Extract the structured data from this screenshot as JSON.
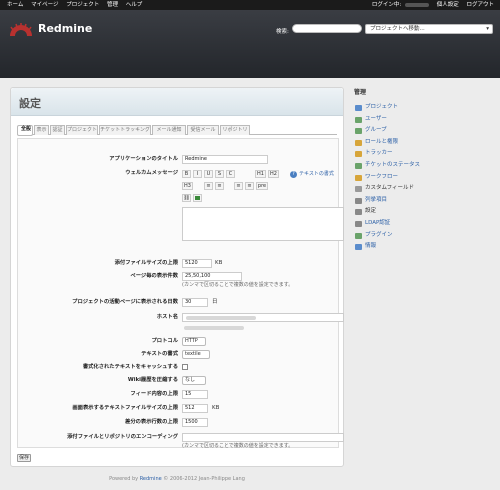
{
  "topmenu": {
    "left": [
      "ホーム",
      "マイページ",
      "プロジェクト",
      "管理",
      "ヘルプ"
    ],
    "login": "ログイン中:",
    "account": "個人設定",
    "logout": "ログアウト"
  },
  "header": {
    "brand": "Redmine",
    "search_label": "検索:",
    "jump": "プロジェクトへ移動..."
  },
  "page": {
    "title": "設定"
  },
  "tabs": [
    "全般",
    "表示",
    "認証",
    "プロジェクト",
    "チケットトラッキング",
    "メール通知",
    "受信メール",
    "リポジトリ"
  ],
  "form": {
    "app_title_label": "アプリケーションのタイトル",
    "app_title": "Redmine",
    "welcome_label": "ウェルカムメッセージ",
    "text_format_link": "テキストの書式",
    "toolbar": [
      "B",
      "I",
      "U",
      "S",
      "C",
      "H1",
      "H2",
      "H3",
      "≡",
      "≡",
      "≡",
      "≡",
      "pre"
    ],
    "attach_label": "添付ファイルサイズの上限",
    "attach_value": "5120",
    "attach_unit": "KB",
    "per_page_label": "ページ毎の表示件数",
    "per_page_value": "25,50,100",
    "per_page_note": "(カンマで区切ることで複数の値を設定できます。",
    "activity_label": "プロジェクトの活動ページに表示される日数",
    "activity_value": "30",
    "activity_unit": "日",
    "hostname_label": "ホスト名",
    "protocol_label": "プロトコル",
    "protocol_value": "HTTP",
    "textformat_label": "テキストの書式",
    "textformat_value": "textile",
    "cache_label": "書式化されたテキストをキャッシュする",
    "wiki_label": "Wiki履歴を圧縮する",
    "wiki_value": "なし",
    "feed_label": "フィード内容の上限",
    "feed_value": "15",
    "filesize_label": "画面表示するテキストファイルサイズの上限",
    "filesize_value": "512",
    "filesize_unit": "KB",
    "diff_label": "差分の表示行数の上限",
    "diff_value": "1500",
    "encoding_label": "添付ファイルとリポジトリのエンコーディング",
    "encoding_note": "(カンマで区切ることで複数の値を設定できます。"
  },
  "save_label": "保存",
  "sidebar": {
    "title": "管理",
    "items": [
      {
        "label": "プロジェクト",
        "color": "#5a8ccc"
      },
      {
        "label": "ユーザー",
        "color": "#6aa36a"
      },
      {
        "label": "グループ",
        "color": "#6aa36a"
      },
      {
        "label": "ロールと権限",
        "color": "#d7a53a"
      },
      {
        "label": "トラッカー",
        "color": "#d7a53a"
      },
      {
        "label": "チケットのステータス",
        "color": "#6aa36a"
      },
      {
        "label": "ワークフロー",
        "color": "#d7a53a"
      },
      {
        "label": "カスタムフィールド",
        "color": "#999999"
      },
      {
        "label": "列挙項目",
        "color": "#888888"
      },
      {
        "label": "設定",
        "color": "#888888"
      },
      {
        "label": "LDAP認証",
        "color": "#888888"
      },
      {
        "label": "プラグイン",
        "color": "#6aa36a"
      },
      {
        "label": "情報",
        "color": "#5a8ccc"
      }
    ]
  },
  "footer": {
    "prefix": "Powered by",
    "brand": "Redmine",
    "suffix": "© 2006-2012 Jean-Philippe Lang"
  }
}
